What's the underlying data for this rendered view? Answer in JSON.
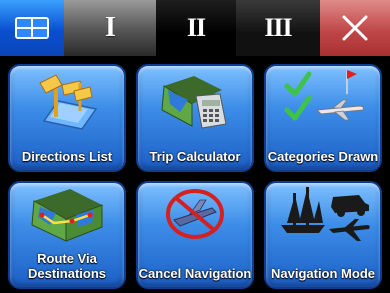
{
  "tabs": [
    {
      "id": "grid",
      "icon": "grid-icon",
      "label": ""
    },
    {
      "id": "one",
      "label": "I"
    },
    {
      "id": "two",
      "label": "II"
    },
    {
      "id": "three",
      "label": "III"
    },
    {
      "id": "close",
      "icon": "close-icon",
      "label": ""
    }
  ],
  "tiles": [
    {
      "label": "Directions List",
      "icon": "directions-list-icon"
    },
    {
      "label": "Trip Calculator",
      "icon": "trip-calculator-icon"
    },
    {
      "label": "Categories Drawn",
      "icon": "categories-drawn-icon"
    },
    {
      "label": "Route Via Destinations",
      "icon": "route-via-destinations-icon"
    },
    {
      "label": "Cancel Navigation",
      "icon": "cancel-navigation-icon"
    },
    {
      "label": "Navigation Mode",
      "icon": "navigation-mode-icon"
    }
  ],
  "colors": {
    "tab_active": "#0a4fd0",
    "tab_close": "#c04848",
    "tile_blue": "#3d8ee8",
    "tile_border": "#0e3d8e"
  }
}
